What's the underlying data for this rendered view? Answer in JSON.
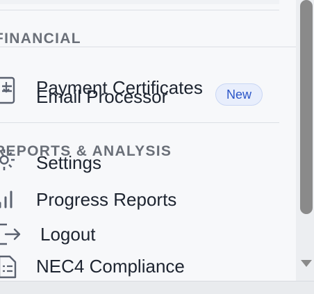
{
  "sections": {
    "financial": "FINANCIAL",
    "reports": "REPORTS & ANALYSIS"
  },
  "nav": {
    "payment_certificates": "Payment Certificates",
    "email_processor": "Email Processor",
    "new_badge": "New",
    "settings": "Settings",
    "progress_reports": "Progress Reports",
    "logout": "Logout",
    "nec4_compliance": "NEC4 Compliance"
  },
  "icons": {
    "payment": "receipt-icon",
    "settings": "gear-icon",
    "progress": "bar-chart-icon",
    "logout": "logout-icon",
    "compliance": "document-icon"
  },
  "colors": {
    "badge_text": "#2a55c8",
    "badge_bg": "#e8eefc",
    "heading": "#6a6f78",
    "label": "#1d2430"
  }
}
